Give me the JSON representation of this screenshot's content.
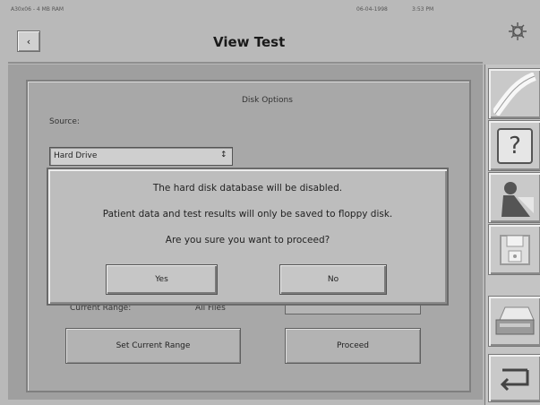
{
  "status": {
    "device": "A30x06 - 4 MB RAM",
    "date": "06-04-1998",
    "time": "3:53 PM"
  },
  "header": {
    "back_label": "‹",
    "title": "View Test"
  },
  "panel": {
    "title": "Disk Options",
    "source_label": "Source:",
    "source_value": "Hard Drive",
    "source_arrow": "↕",
    "current_range_label": "Current Range:",
    "current_range_value": "All Files",
    "set_range_label": "Set Current Range",
    "proceed_label": "Proceed"
  },
  "dialog": {
    "line1": "The hard disk database will be disabled.",
    "line2": "Patient data and test results will only be saved to floppy disk.",
    "line3": "Are you sure you want to proceed?",
    "yes_label": "Yes",
    "no_label": "No"
  },
  "sidebar": {
    "items": [
      {
        "icon": "curve-icon"
      },
      {
        "icon": "help-icon",
        "glyph": "?"
      },
      {
        "icon": "patient-icon"
      },
      {
        "icon": "floppy-disk-icon"
      },
      {
        "icon": "printer-icon"
      },
      {
        "icon": "return-icon"
      }
    ]
  }
}
